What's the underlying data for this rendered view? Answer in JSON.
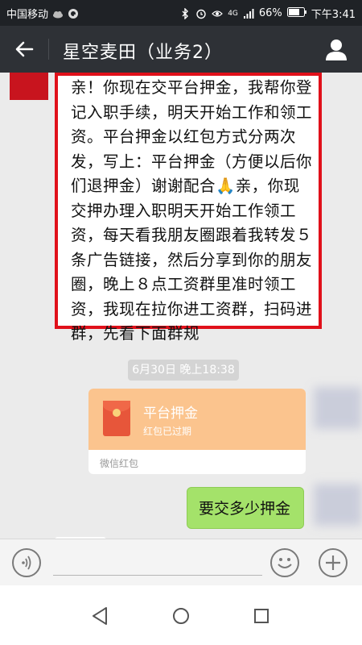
{
  "status_bar": {
    "carrier": "中国移动",
    "network": "4G",
    "battery": "66%",
    "time": "下午3:41"
  },
  "header": {
    "title": "星空麦田（业务2）"
  },
  "messages": {
    "text": "亲！你现在交平台押金，我帮你登记入职手续，明天开始工作和领工资。平台押金以红包方式分两次发，写上：平台押金（方便以后你们退押金）谢谢配合🙏亲，你现交押办理入职明天开始工作领工资，每天看我朋友圈跟着我转发５条广告链接，然后分享到你的朋友圈，晚上８点工资群里准时领工资，我现在拉你进工资群，扫码进群，先看下面群规",
    "timestamp": "6月30日 晚上18:38",
    "red_packet": {
      "title": "平台押金",
      "status": "红包已过期",
      "footer": "微信红包"
    },
    "reply": "要交多少押金"
  },
  "colors": {
    "header_bg": "#2e3136",
    "highlight_border": "#e0101a",
    "bubble_green": "#a4e26a",
    "red_packet": "#fbc48e"
  }
}
